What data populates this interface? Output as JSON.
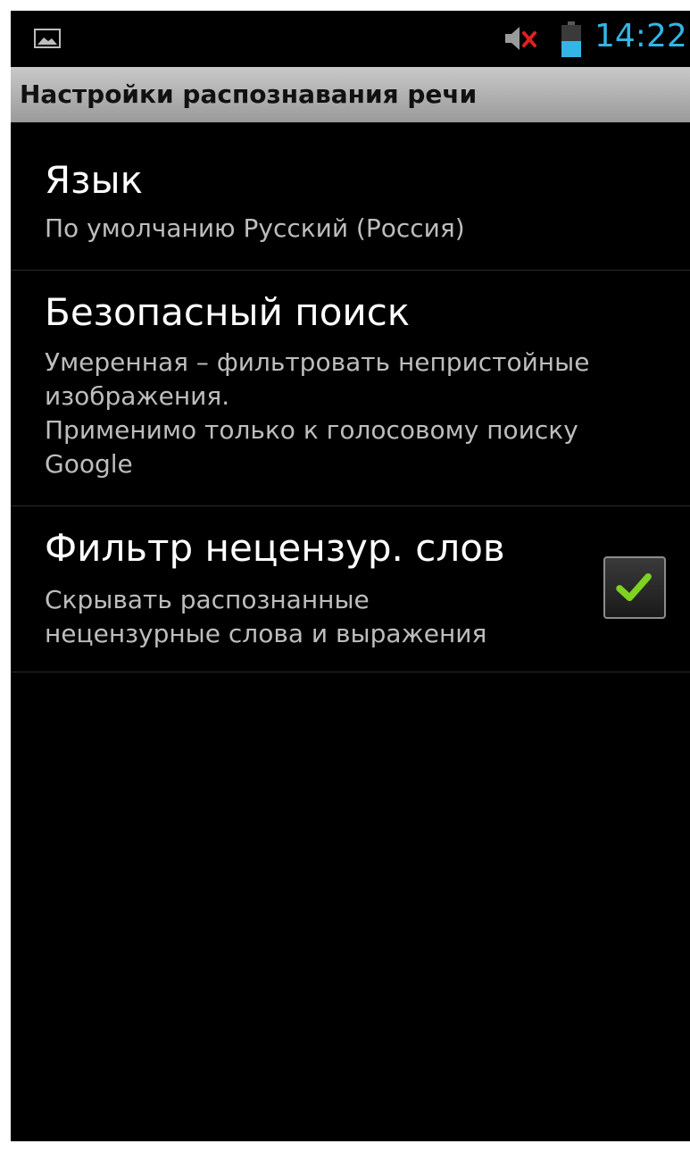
{
  "status_bar": {
    "time": "14:22",
    "notification_icon": "image-icon",
    "mute_icon": "volume-muted-icon",
    "battery_icon": "battery-icon",
    "time_color": "#33b5e5",
    "mute_color": "#e02020"
  },
  "action_bar": {
    "title": "Настройки распознавания речи"
  },
  "preferences": [
    {
      "title": "Язык",
      "summary": "По умолчанию Русский (Россия)"
    },
    {
      "title": "Безопасный поиск",
      "summary": "Умеренная – фильтровать непристойные\nизображения.\nПрименимо только к голосовому поиску\nGoogle"
    },
    {
      "title": "Фильтр нецензур. слов",
      "summary": "Скрывать распознанные\nнецензурные слова и выражения",
      "checked": true,
      "check_color": "#7ed321"
    }
  ]
}
